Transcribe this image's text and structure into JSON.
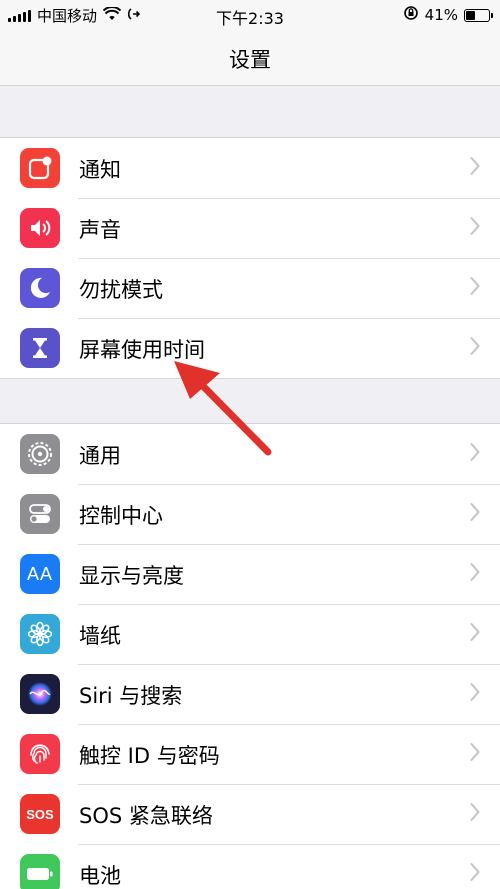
{
  "status": {
    "carrier": "中国移动",
    "time": "下午2:33",
    "battery_percent": "41%",
    "battery_level": 0.41
  },
  "nav": {
    "title": "设置"
  },
  "groups": [
    {
      "items": [
        {
          "label": "通知",
          "icon": "notifications-icon",
          "color": "#f24237"
        },
        {
          "label": "声音",
          "icon": "sounds-icon",
          "color": "#f2334f"
        },
        {
          "label": "勿扰模式",
          "icon": "do-not-disturb-moon-icon",
          "color": "#5d56d6"
        },
        {
          "label": "屏幕使用时间",
          "icon": "screen-time-hourglass-icon",
          "color": "#5a52c9"
        }
      ]
    },
    {
      "items": [
        {
          "label": "通用",
          "icon": "general-gear-icon",
          "color": "#8e8e93"
        },
        {
          "label": "控制中心",
          "icon": "control-center-toggles-icon",
          "color": "#8e8e93"
        },
        {
          "label": "显示与亮度",
          "icon": "display-brightness-aa-icon",
          "color": "#1a7cf5"
        },
        {
          "label": "墙纸",
          "icon": "wallpaper-flower-icon",
          "color": "#34a9d8"
        },
        {
          "label": "Siri 与搜索",
          "icon": "siri-icon",
          "color": "#1c1c3c"
        },
        {
          "label": "触控 ID 与密码",
          "icon": "touch-id-fingerprint-icon",
          "color": "#f23a4b"
        },
        {
          "label": "SOS 紧急联络",
          "icon": "emergency-sos-icon",
          "color": "#e8352d"
        },
        {
          "label": "电池",
          "icon": "battery-icon",
          "color": "#41c85a"
        }
      ]
    }
  ],
  "icon_text": {
    "aa": "AA",
    "sos": "SOS"
  }
}
